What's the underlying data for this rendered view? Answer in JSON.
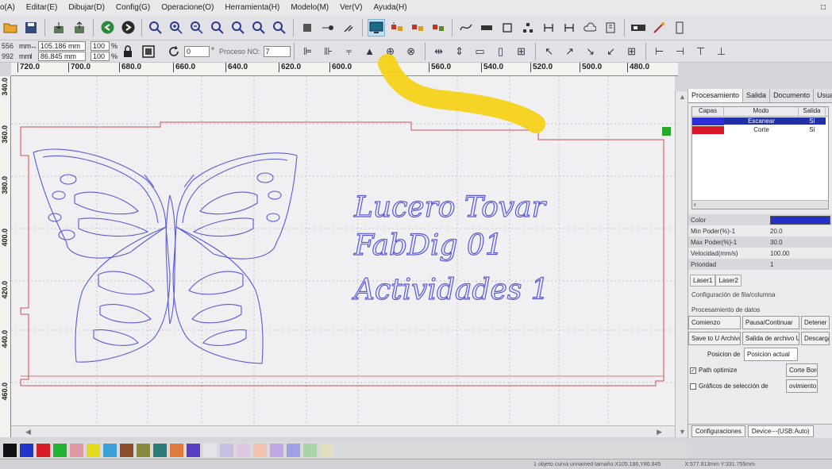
{
  "menu": [
    "o(A)",
    "Editar(E)",
    "Dibujar(D)",
    "Config(G)",
    "Operacione(O)",
    "Herramienta(H)",
    "Modelo(M)",
    "Ver(V)",
    "Ayuda(H)"
  ],
  "window_btn": "□",
  "position": {
    "x_prefix": "556",
    "y_prefix": "992",
    "x_unit": "mm",
    "y_unit": "mm",
    "x_value": "105.186 mm",
    "y_value": "86.845 mm"
  },
  "scale": {
    "x": "100",
    "y": "100",
    "unit": "%"
  },
  "rotation": {
    "value": "0",
    "unit": "°"
  },
  "process": {
    "label": "Proceso NO:",
    "value": "7"
  },
  "ruler_h": [
    "720.0",
    "700.0",
    "680.0",
    "660.0",
    "640.0",
    "620.0",
    "600.0",
    "560.0",
    "540.0",
    "520.0",
    "500.0",
    "480.0"
  ],
  "ruler_v": [
    "340.0",
    "360.0",
    "380.0",
    "400.0",
    "420.0",
    "440.0",
    "460.0"
  ],
  "design_text": [
    "Lucero Tovar",
    "FabDig 01",
    "Actividades 1"
  ],
  "panel": {
    "tabs": [
      "Procesamiento",
      "Salida",
      "Documento",
      "Usuario"
    ],
    "layer_headers": [
      "Capas",
      "Modo",
      "Salida"
    ],
    "layers": [
      {
        "mode": "Escanear",
        "output": "Sí",
        "color": "#2a2fd6"
      },
      {
        "mode": "Corte",
        "output": "Sí",
        "color": "#d8182a"
      }
    ],
    "props": [
      {
        "label": "Color",
        "value": ""
      },
      {
        "label": "Min Poder(%)-1",
        "value": "20.0"
      },
      {
        "label": "Max Poder(%)-1",
        "value": "30.0"
      },
      {
        "label": "Velocidad(mm/s)",
        "value": "100.00"
      },
      {
        "label": "Prioridad",
        "value": "1"
      }
    ],
    "laser_tabs": [
      "Laser1",
      "Laser2"
    ],
    "row_col_config": "Configuración de fila/columna",
    "data_processing": "Procesamiento de datos",
    "btn_start": "Comienzo",
    "btn_pause": "Pausa/Continuar",
    "btn_stop": "Detener",
    "btn_save_udisk": "Save to U Archivo",
    "btn_output_udisk": "Salida de archivo U",
    "btn_download": "Descargar",
    "position_label": "Posicion de",
    "position_value": "Posicion actual",
    "path_optimize": "Path optimize",
    "selection_graphics": "Gráficos de selección de",
    "cut_box": "Corte Bord",
    "box_other": "ovimiento B",
    "config_btn": "Configuraciones",
    "device": "Device---(USB:Auto)"
  },
  "palette": [
    "#101014",
    "#2233c8",
    "#d81c24",
    "#22b430",
    "#e09aa4",
    "#e4d820",
    "#3aa0d8",
    "#8c4c2c",
    "#8a8a3c",
    "#2a7c78",
    "#e07a3c",
    "#5a3cc8",
    "#e4e4ea",
    "#c8c0e4",
    "#dcc8e0",
    "#f0c4b0",
    "#c0a8e0",
    "#a0a0e8",
    "#a8d4a8",
    "#e0e0c0"
  ],
  "status": {
    "left": "1 objeto curva unnamed tamaño:X105.186,Y86.845",
    "right": "X:577.813mm Y:331.755mm"
  },
  "colors": {
    "accent_blue": "#2230c8",
    "cut_red": "#c83030",
    "highlight_yellow": "#f4d21a"
  }
}
